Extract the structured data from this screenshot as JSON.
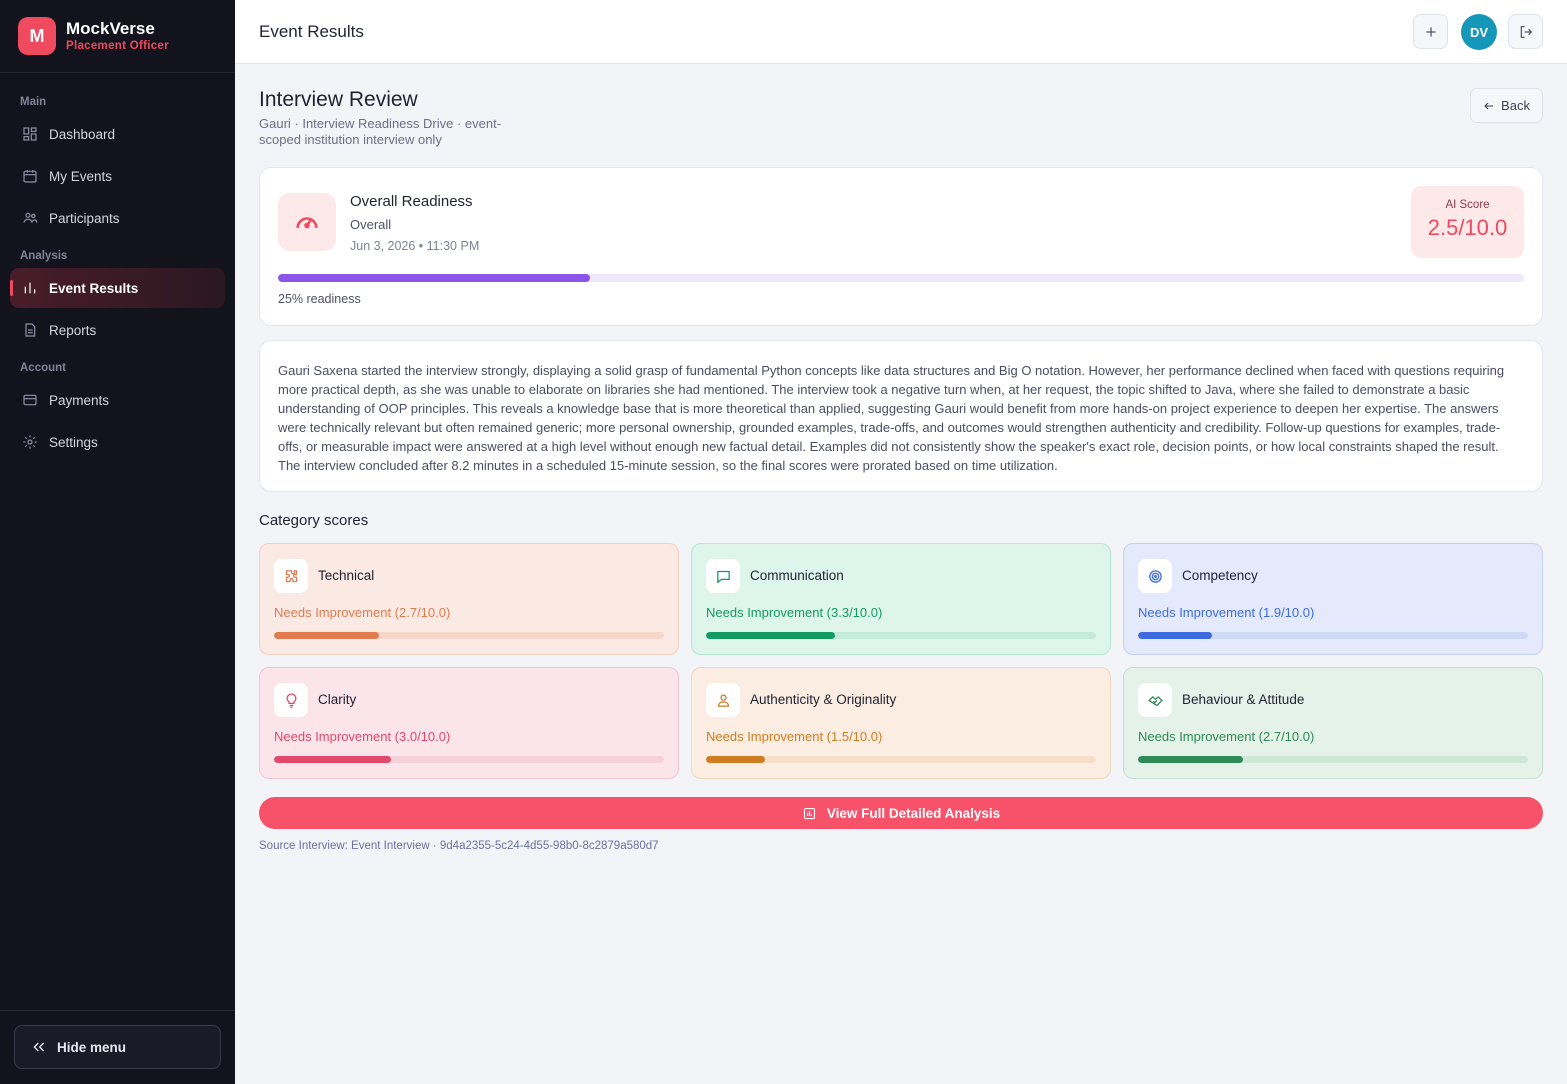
{
  "brand": {
    "logo_letter": "M",
    "name": "MockVerse",
    "role": "Placement Officer"
  },
  "sidebar": {
    "sections": [
      {
        "label": "Main"
      },
      {
        "label": "Analysis"
      },
      {
        "label": "Account"
      }
    ],
    "items": [
      {
        "label": "Dashboard",
        "icon": "dashboard-icon"
      },
      {
        "label": "My Events",
        "icon": "calendar-icon"
      },
      {
        "label": "Participants",
        "icon": "users-icon"
      },
      {
        "label": "Event Results",
        "icon": "bar-chart-icon",
        "active": true
      },
      {
        "label": "Reports",
        "icon": "document-icon"
      },
      {
        "label": "Payments",
        "icon": "credit-card-icon"
      },
      {
        "label": "Settings",
        "icon": "gear-icon"
      }
    ],
    "hide_menu_label": "Hide menu"
  },
  "header": {
    "title": "Event Results",
    "avatar_initials": "DV"
  },
  "page": {
    "title": "Interview Review",
    "subtitle": "Gauri · Interview Readiness Drive · event-scoped institution interview only",
    "back_label": "Back"
  },
  "readiness": {
    "title": "Overall Readiness",
    "category": "Overall",
    "datetime": "Jun 3, 2026 • 11:30 PM",
    "ai_score_label": "AI Score",
    "ai_score_value": "2.5/10.0",
    "progress_percent": 25,
    "caption": "25% readiness",
    "accent_color": "#8a55e8"
  },
  "summary": {
    "text": "Gauri Saxena started the interview strongly, displaying a solid grasp of fundamental Python concepts like data structures and Big O notation. However, her performance declined when faced with questions requiring more practical depth, as she was unable to elaborate on libraries she had mentioned. The interview took a negative turn when, at her request, the topic shifted to Java, where she failed to demonstrate a basic understanding of OOP principles. This reveals a knowledge base that is more theoretical than applied, suggesting Gauri would benefit from more hands-on project experience to deepen her expertise. The answers were technically relevant but often remained generic; more personal ownership, grounded examples, trade-offs, and outcomes would strengthen authenticity and credibility. Follow-up questions for examples, trade-offs, or measurable impact were answered at a high level without enough new factual detail. Examples did not consistently show the speaker's exact role, decision points, or how local constraints shaped the result. The interview concluded after 8.2 minutes in a scheduled 15-minute session, so the final scores were prorated based on time utilization."
  },
  "categories": {
    "title": "Category scores",
    "items": [
      {
        "name": "Technical",
        "status": "Needs Improvement (2.7/10.0)",
        "score": 2.7,
        "max": 10,
        "icon": "puzzle-icon",
        "color": "#e07a4f",
        "bg": "#fbeae3",
        "border": "#f3cfc0",
        "track": "#f6d7ca"
      },
      {
        "name": "Communication",
        "status": "Needs Improvement (3.3/10.0)",
        "score": 3.3,
        "max": 10,
        "icon": "chat-icon",
        "color": "#139a62",
        "bg": "#def5ec",
        "border": "#b7e6d1",
        "track": "#c3eadb"
      },
      {
        "name": "Competency",
        "status": "Needs Improvement (1.9/10.0)",
        "score": 1.9,
        "max": 10,
        "icon": "target-icon",
        "color": "#3c6be0",
        "bg": "#e4eafb",
        "border": "#c5d2f4",
        "track": "#cfdaf7"
      },
      {
        "name": "Clarity",
        "status": "Needs Improvement (3.0/10.0)",
        "score": 3.0,
        "max": 10,
        "icon": "lightbulb-icon",
        "color": "#e0496b",
        "bg": "#fbe5ea",
        "border": "#f3c6d1",
        "track": "#f6d1da"
      },
      {
        "name": "Authenticity & Originality",
        "status": "Needs Improvement (1.5/10.0)",
        "score": 1.5,
        "max": 10,
        "icon": "person-icon",
        "color": "#cf7d22",
        "bg": "#fbede2",
        "border": "#f2d8bf",
        "track": "#f5dfc9"
      },
      {
        "name": "Behaviour & Attitude",
        "status": "Needs Improvement (2.7/10.0)",
        "score": 2.7,
        "max": 10,
        "icon": "handshake-icon",
        "color": "#2e8a56",
        "bg": "#e5f2ea",
        "border": "#c4e1cf",
        "track": "#cfe7d8"
      }
    ]
  },
  "cta": {
    "label": "View Full Detailed Analysis",
    "icon": "report-chart-icon",
    "color": "#f8526a"
  },
  "source": "Source Interview: Event Interview · 9d4a2355-5c24-4d55-98b0-8c2879a580d7"
}
